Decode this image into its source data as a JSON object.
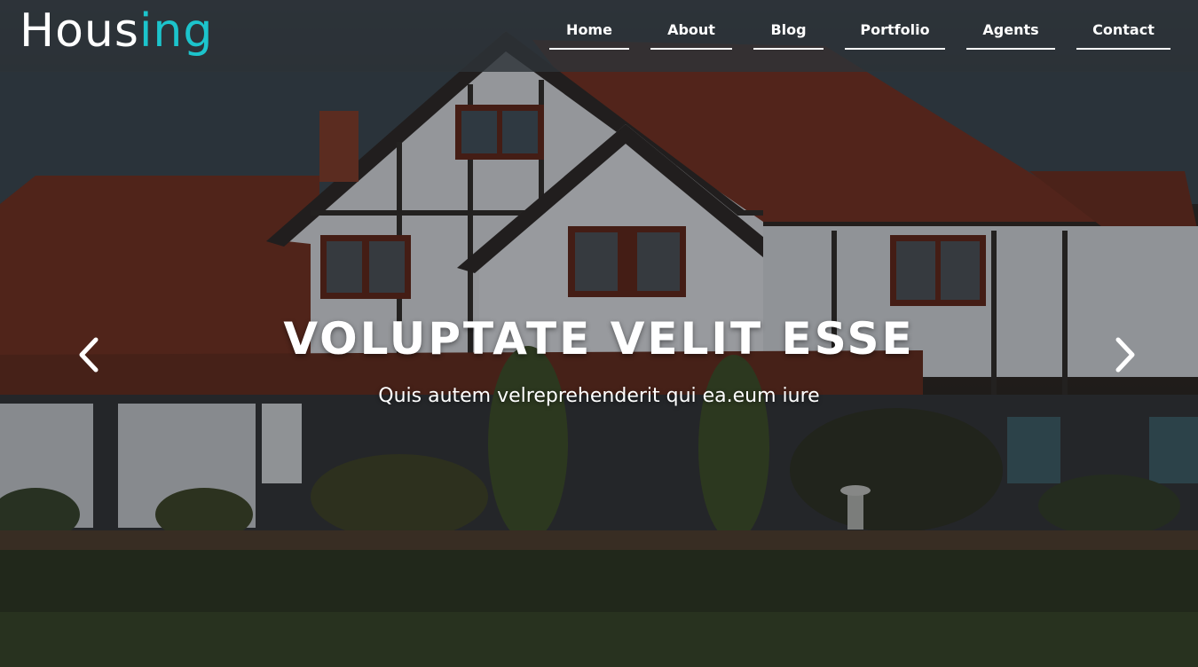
{
  "logo": {
    "part1": "Hous",
    "part2": "ing"
  },
  "nav": {
    "items": [
      {
        "label": "Home"
      },
      {
        "label": "About"
      },
      {
        "label": "Blog"
      },
      {
        "label": "Portfolio"
      },
      {
        "label": "Agents"
      },
      {
        "label": "Contact"
      }
    ]
  },
  "slider": {
    "title": "VOLUPTATE VELIT ESSE",
    "subtitle": "Quis autem velreprehenderit qui ea.eum iure",
    "prev_icon": "chevron-left-icon",
    "next_icon": "chevron-right-icon"
  },
  "colors": {
    "accent": "#1cc4cc",
    "header_bg": "#2d3338",
    "text": "#ffffff"
  }
}
